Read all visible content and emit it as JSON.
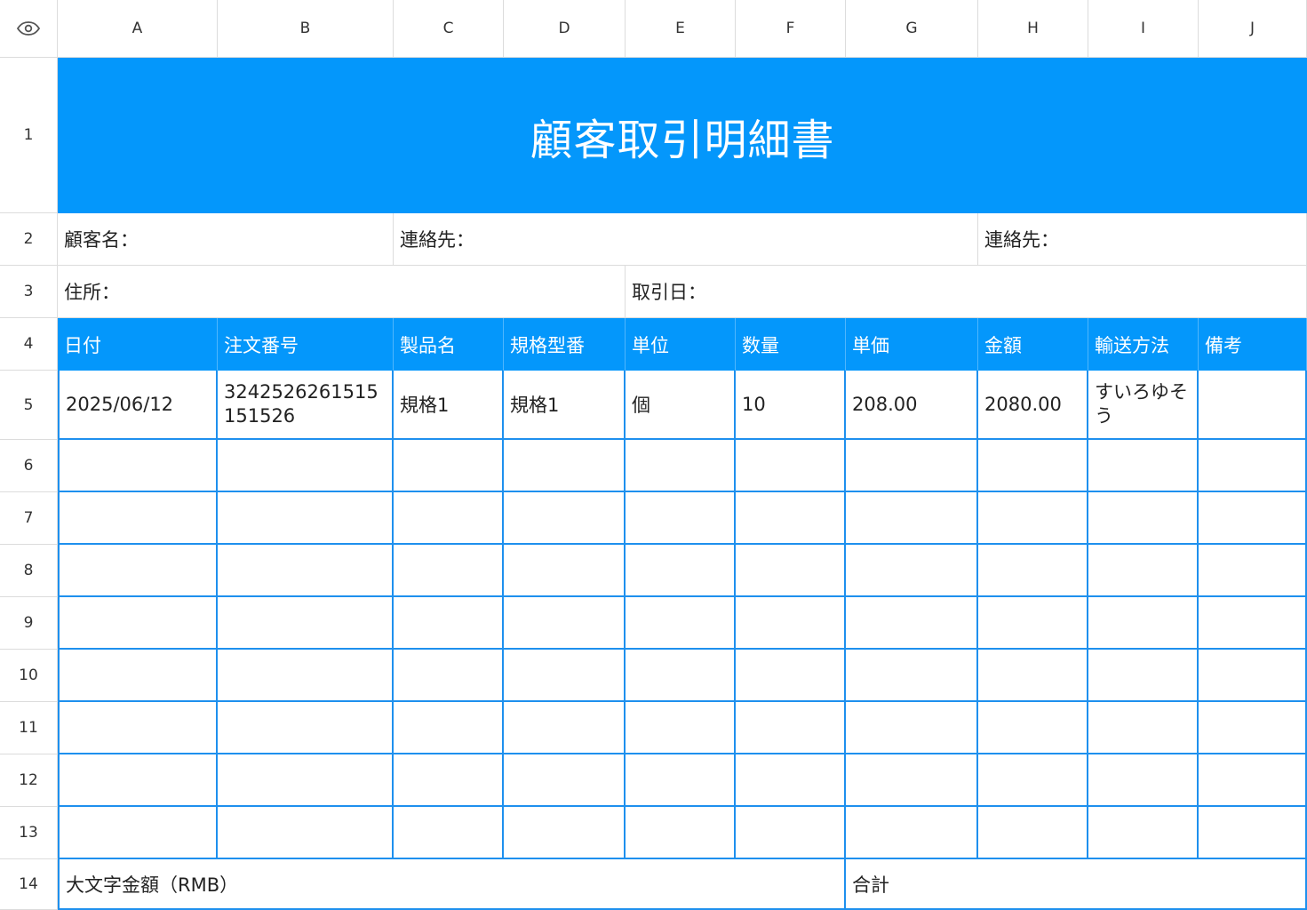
{
  "columns": [
    "A",
    "B",
    "C",
    "D",
    "E",
    "F",
    "G",
    "H",
    "I",
    "J"
  ],
  "rows": [
    "1",
    "2",
    "3",
    "4",
    "5",
    "6",
    "7",
    "8",
    "9",
    "10",
    "11",
    "12",
    "13",
    "14"
  ],
  "title": "顧客取引明細書",
  "info": {
    "customer_name": "顧客名：",
    "contact_1": "連絡先：",
    "contact_2": "連絡先：",
    "address": "住所：",
    "trade_date": "取引日："
  },
  "table_headers": [
    "日付",
    "注文番号",
    "製品名",
    "規格型番",
    "単位",
    "数量",
    "単価",
    "金額",
    "輸送方法",
    "備考"
  ],
  "table_rows": [
    [
      "2025/06/12",
      "3242526261515151526",
      "規格1",
      "規格1",
      "個",
      "10",
      "208.00",
      "2080.00",
      "すいろゆそう",
      ""
    ]
  ],
  "footer": {
    "amount_in_words": "大文字金額（RMB）",
    "total": "合計"
  },
  "colors": {
    "accent": "#0497fb",
    "grid_line": "#1e90ee"
  },
  "icons": {
    "corner": "eye-icon"
  }
}
